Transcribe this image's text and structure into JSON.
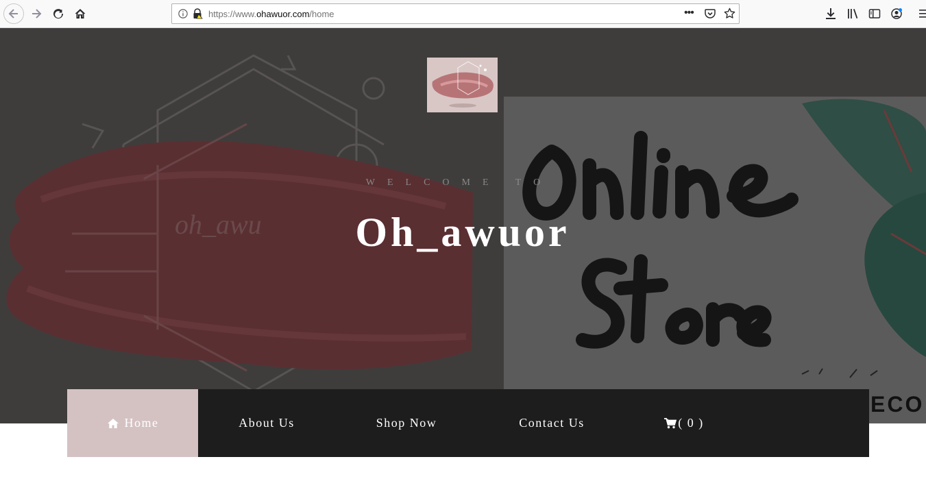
{
  "browser": {
    "url_prefix": "https://www.",
    "url_domain": "ohawuor.com",
    "url_path": "/home",
    "more_label": "•••"
  },
  "hero": {
    "welcome": "WELCOME TO",
    "brand": "Oh_awuor"
  },
  "nav": {
    "items": [
      {
        "label": "Home",
        "icon": "home-icon",
        "active": true
      },
      {
        "label": "About Us"
      },
      {
        "label": "Shop Now"
      },
      {
        "label": "Contact Us"
      },
      {
        "label": "( 0 )",
        "icon": "cart-icon"
      }
    ]
  },
  "colors": {
    "hero_bg": "#3f3d3c",
    "nav_bg": "#1d1d1d",
    "nav_active": "#d4c2c3",
    "brush": "#5a2f32"
  }
}
